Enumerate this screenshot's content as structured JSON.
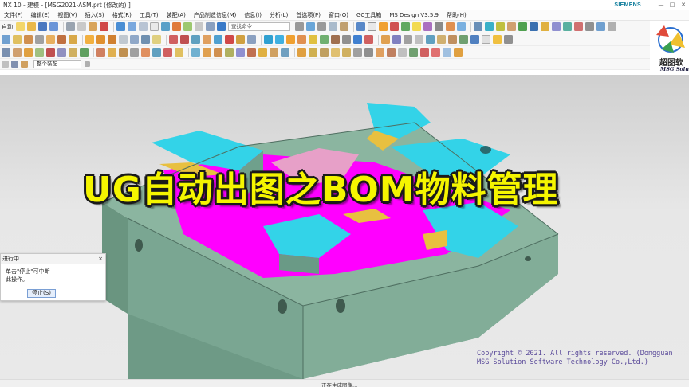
{
  "window": {
    "title": "NX 10 - 建模 - [MSG2021-ASM.prt  (修改的) ]",
    "brand": "SIEMENS"
  },
  "menu": {
    "items": [
      "文件(F)",
      "编辑(E)",
      "视图(V)",
      "插入(S)",
      "格式(R)",
      "工具(T)",
      "装配(A)",
      "产品制造信息(M)",
      "信息(I)",
      "分析(L)",
      "首选项(P)",
      "窗口(O)",
      "GC工具箱",
      "MS Design V3.5.9",
      "帮助(H)"
    ]
  },
  "toolbar": {
    "auto_label": "自动",
    "find_command_placeholder": "查找命令",
    "assembly_select": "整个装配"
  },
  "logo": {
    "text": "超图软",
    "sub": "MSG Solu"
  },
  "viewport": {
    "headline": "UG自动出图之BOM物料管理",
    "headline_color": "#f5f500",
    "copyright_line1": "Copyright © 2021. All rights reserved. (Dongguan",
    "copyright_line2": "MSG Solution Software Technology Co.,Ltd.)",
    "part_colors": {
      "base": "#7fa894",
      "cavity": "#ff00ff",
      "top_face": "#33d3e8",
      "insert": "#e8c040",
      "pink_core": "#e7a0c8"
    }
  },
  "dialog": {
    "title": "进行中",
    "close": "×",
    "message_line1": "单击\"停止\"可中断",
    "message_line2": "此操作。",
    "stop_button": "停止(S)"
  },
  "status": {
    "text": "正在生成图像..."
  }
}
